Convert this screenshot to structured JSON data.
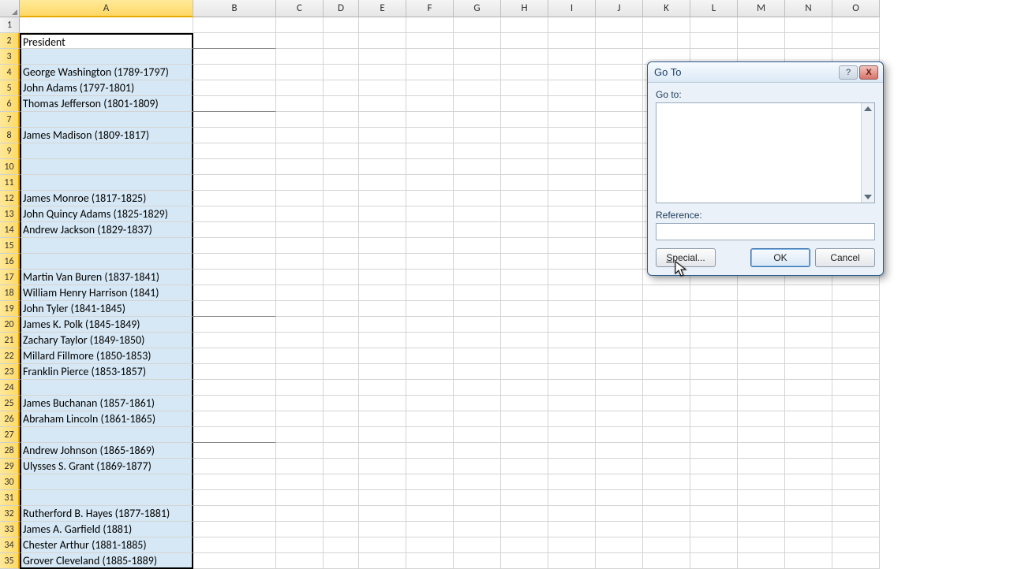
{
  "columns": [
    "A",
    "B",
    "C",
    "D",
    "E",
    "F",
    "G",
    "H",
    "I",
    "J",
    "K",
    "L",
    "M",
    "N",
    "O"
  ],
  "col_classes": [
    "cA",
    "cB",
    "cC",
    "cD",
    "cE",
    "cF",
    "cG",
    "cH",
    "cI",
    "cJ",
    "cK",
    "cL",
    "cM",
    "cN",
    "cO"
  ],
  "selected_col_index": 0,
  "row_count": 35,
  "selected_row_start": 2,
  "selected_row_end": 35,
  "active_row": 2,
  "underline_b_rows": [
    2,
    6,
    19,
    27
  ],
  "cells_a": {
    "2": "President",
    "4": "George Washington (1789-1797)",
    "5": "John Adams (1797-1801)",
    "6": "Thomas Jefferson (1801-1809)",
    "8": "James Madison (1809-1817)",
    "12": "James Monroe (1817-1825)",
    "13": "John Quincy Adams (1825-1829)",
    "14": "Andrew Jackson (1829-1837)",
    "17": "Martin Van Buren (1837-1841)",
    "18": "William Henry Harrison (1841)",
    "19": "John Tyler (1841-1845)",
    "20": "James K. Polk (1845-1849)",
    "21": "Zachary Taylor (1849-1850)",
    "22": "Millard Fillmore (1850-1853)",
    "23": "Franklin Pierce (1853-1857)",
    "25": "James Buchanan (1857-1861)",
    "26": "Abraham Lincoln (1861-1865)",
    "28": "Andrew Johnson (1865-1869)",
    "29": "Ulysses S. Grant (1869-1877)",
    "32": "Rutherford B. Hayes (1877-1881)",
    "33": "James A. Garfield (1881)",
    "34": "Chester Arthur (1881-1885)",
    "35": "Grover Cleveland (1885-1889)"
  },
  "dialog": {
    "title": "Go To",
    "help_glyph": "?",
    "close_glyph": "X",
    "goto_label": "Go to:",
    "reference_label": "Reference:",
    "reference_value": "",
    "special_s": "S",
    "special_rest": "pecial...",
    "ok": "OK",
    "cancel": "Cancel"
  }
}
